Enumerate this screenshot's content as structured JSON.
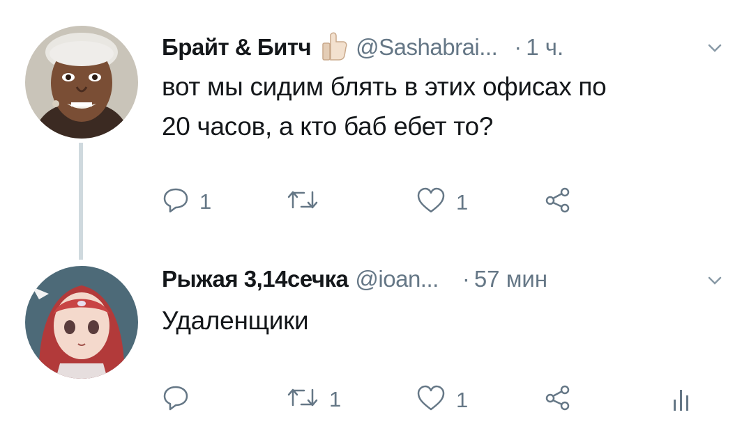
{
  "tweets": [
    {
      "author_name": "Брайт & Битч",
      "handle": "@Sashabrai...",
      "time_sep": "·",
      "time": "1 ч.",
      "text_line1": "вот мы сидим блять в этих офисах по",
      "text_line2": "20 часов, а кто баб ебет то?",
      "reply_count": "1",
      "retweet_count": "",
      "like_count": "1"
    },
    {
      "author_name": "Рыжая 3,14сечка",
      "handle": "@ioan...",
      "time_sep": "·",
      "time": "57 мин",
      "text_line1": "Удаленщики",
      "reply_count": "",
      "retweet_count": "1",
      "like_count": "1"
    }
  ],
  "icons": {
    "author_badge": "thumbs-up-emoji",
    "reply": "reply-icon",
    "retweet": "retweet-icon",
    "like": "like-icon",
    "share": "share-icon",
    "analytics": "analytics-icon",
    "menu": "chevron-down-icon"
  },
  "colors": {
    "text": "#14171a",
    "secondary": "#657786",
    "thread_line": "#cfd9de",
    "background": "#ffffff"
  }
}
